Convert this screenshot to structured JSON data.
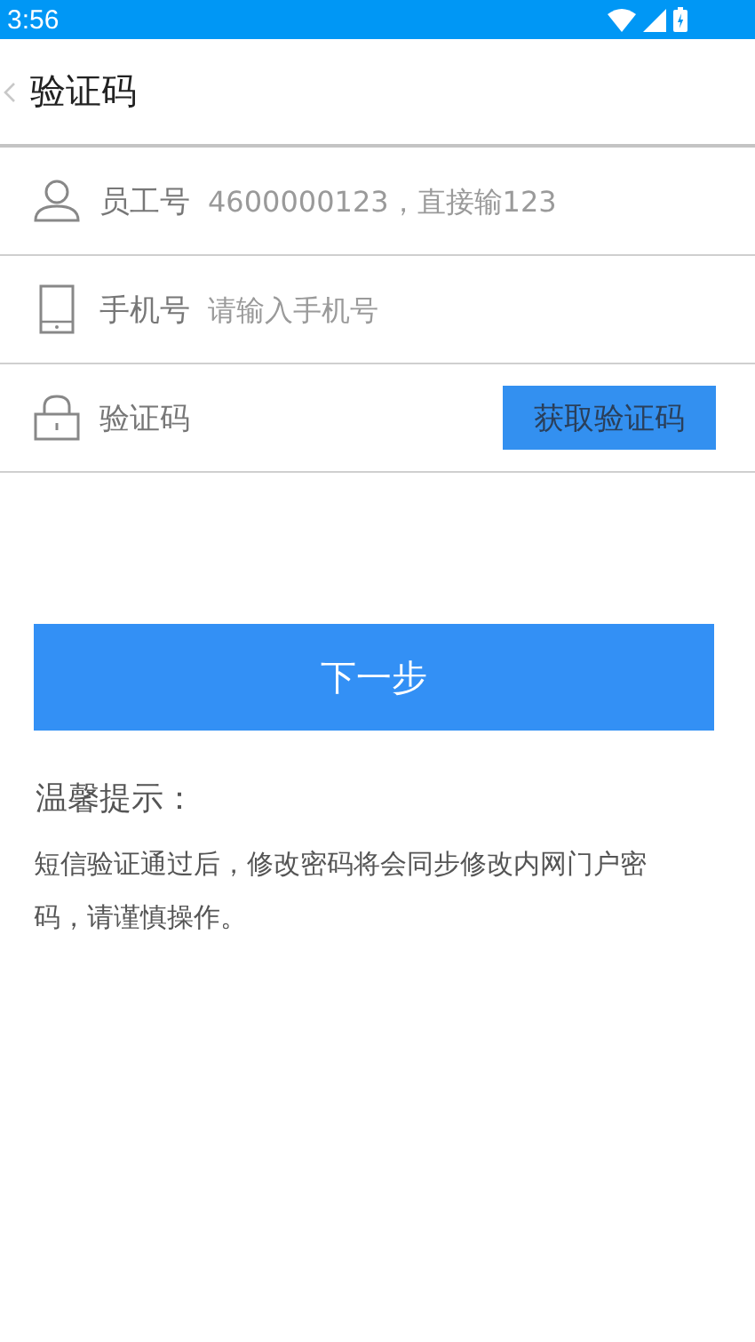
{
  "status_bar": {
    "time": "3:56"
  },
  "header": {
    "title": "验证码"
  },
  "fields": [
    {
      "label": "员工号",
      "placeholder": "4600000123，直接输123"
    },
    {
      "label": "手机号",
      "placeholder": "请输入手机号"
    },
    {
      "label": "验证码",
      "button": "获取验证码"
    }
  ],
  "next_button": "下一步",
  "tips": {
    "title": "温馨提示：",
    "text": "短信验证通过后，修改密码将会同步修改内网门户密码，请谨慎操作。"
  }
}
